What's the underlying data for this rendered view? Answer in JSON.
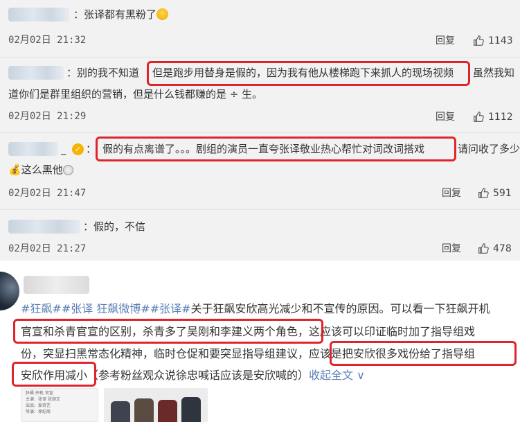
{
  "comments": [
    {
      "separator": "：",
      "text_segments": [
        "张译都有黑粉了"
      ],
      "time": "02月02日 21:32",
      "reply_label": "回复",
      "likes": "1143"
    },
    {
      "separator": "：",
      "text_line1_a": "别的我不知道",
      "text_line1_hl": "但是跑步用替身是假的，因为我有他从楼梯跑下来抓人的现场视频",
      "text_line1_b": "虽然我知",
      "text_line2": "道你们是群里组织的营销，但是什么钱都赚的是 ÷ 生。",
      "time": "02月02日 21:29",
      "reply_label": "回复",
      "likes": "1112"
    },
    {
      "separator": "_",
      "text_line1_hl": "假的有点离谱了。。。剧组的演员一直夸张译敬业热心帮忙对词改词搭戏",
      "text_line1_b": "请问收了多少",
      "text_line2": "这么黑他",
      "time": "02月02日 21:47",
      "reply_label": "回复",
      "likes": "591"
    },
    {
      "separator": "：",
      "text": "假的，不信",
      "time": "02月02日 21:27",
      "reply_label": "回复",
      "likes": "478"
    }
  ],
  "post": {
    "tags": "#狂飙##张译 狂飙微博##张译#",
    "line1_rest": "关于狂飙安欣高光减少和不宣传的原因。可以看一下狂飙开机",
    "line2_hl1": "官宣和杀青官宣的区别，杀青多了吴刚和李建义两个角色",
    "line2_rest": "，这应该可以印证临时加了指导组戏",
    "line3_a": "份，突显扫黑常态化精神，临时仓促和要突显指导组建议，",
    "line3_hl": "应该是把安欣很多戏份给了指导组",
    "line4_hl": "安欣作用减小",
    "line4_rest": "（参考粉丝观众说徐忠喊话应该是安欣喊的）",
    "collapse_label": "收起全文",
    "thumb_lines": [
      "狂飙 开机 官宣",
      "主演：张译 张颂文",
      "出品：爱奇艺",
      "导演：徐纪周"
    ]
  },
  "colors": {
    "highlight": "#e0242b",
    "link": "#5b7fb5",
    "panel_bg": "#f2f2f2"
  },
  "icons": [
    "thumbs-up-icon",
    "verified-badge-icon",
    "laugh-cry-emoji",
    "money-bag-emoji",
    "smile-emoji",
    "chevron-down-icon"
  ]
}
